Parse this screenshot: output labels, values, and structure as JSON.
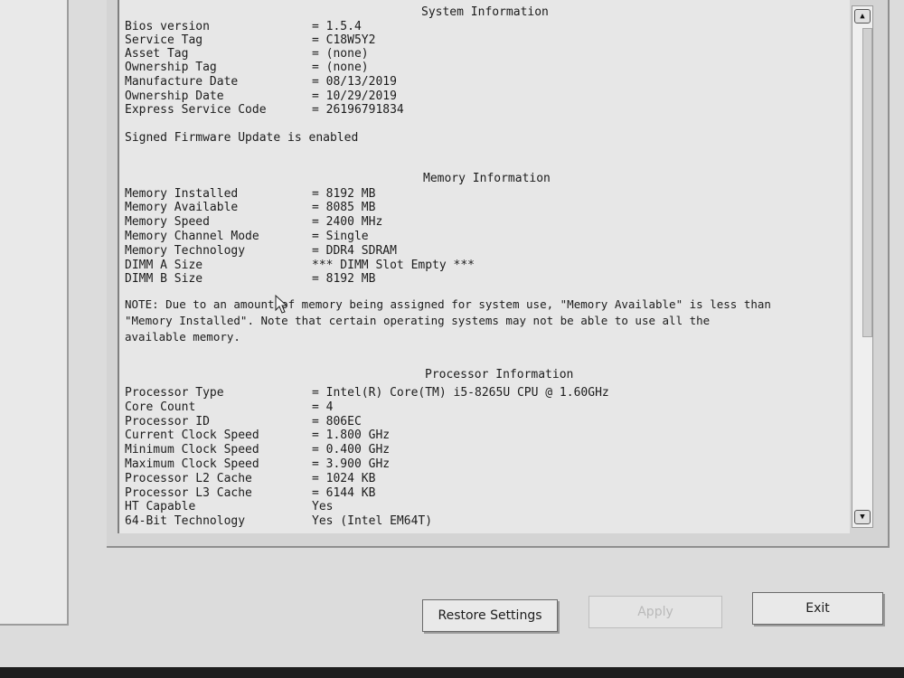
{
  "system_info": {
    "title": "System Information",
    "rows": [
      {
        "label": "Bios version",
        "value": "= 1.5.4"
      },
      {
        "label": "Service Tag",
        "value": "= C18W5Y2"
      },
      {
        "label": "Asset Tag",
        "value": "= (none)"
      },
      {
        "label": "Ownership Tag",
        "value": "= (none)"
      },
      {
        "label": "Manufacture Date",
        "value": "= 08/13/2019"
      },
      {
        "label": "Ownership Date",
        "value": "= 10/29/2019"
      },
      {
        "label": "Express Service Code",
        "value": "= 26196791834"
      }
    ],
    "firmware_note": "Signed Firmware Update is enabled"
  },
  "memory_info": {
    "title": "Memory Information",
    "rows": [
      {
        "label": "Memory Installed",
        "value": "= 8192 MB"
      },
      {
        "label": "Memory Available",
        "value": "= 8085 MB"
      },
      {
        "label": "Memory Speed",
        "value": "= 2400 MHz"
      },
      {
        "label": "Memory Channel Mode",
        "value": "= Single"
      },
      {
        "label": "Memory Technology",
        "value": "= DDR4 SDRAM"
      },
      {
        "label": "DIMM A Size",
        "value": "*** DIMM Slot Empty ***"
      },
      {
        "label": "DIMM B Size",
        "value": "= 8192 MB"
      }
    ],
    "note": "NOTE: Due to an amount of memory being assigned for system use, \"Memory Available\" is less than \"Memory Installed\". Note that certain operating systems may not be able to use all the available memory."
  },
  "processor_info": {
    "title": "Processor Information",
    "rows": [
      {
        "label": "Processor Type",
        "value": "= Intel(R) Core(TM) i5-8265U CPU @ 1.60GHz"
      },
      {
        "label": "Core Count",
        "value": "= 4"
      },
      {
        "label": "Processor ID",
        "value": "= 806EC"
      },
      {
        "label": "Current Clock Speed",
        "value": "= 1.800 GHz"
      },
      {
        "label": "Minimum Clock Speed",
        "value": "= 0.400 GHz"
      },
      {
        "label": "Maximum Clock Speed",
        "value": "= 3.900 GHz"
      },
      {
        "label": "Processor L2 Cache",
        "value": "= 1024 KB"
      },
      {
        "label": "Processor L3 Cache",
        "value": "= 6144 KB"
      },
      {
        "label": "HT Capable",
        "value": "Yes"
      },
      {
        "label": "64-Bit Technology",
        "value": "Yes (Intel EM64T)"
      }
    ]
  },
  "scrollbar": {
    "up_icon": "arrow-up-icon",
    "down_icon": "arrow-down-icon",
    "position_fraction": 0.0
  },
  "buttons": {
    "restore": "Restore Settings",
    "apply": "Apply",
    "exit": "Exit"
  }
}
